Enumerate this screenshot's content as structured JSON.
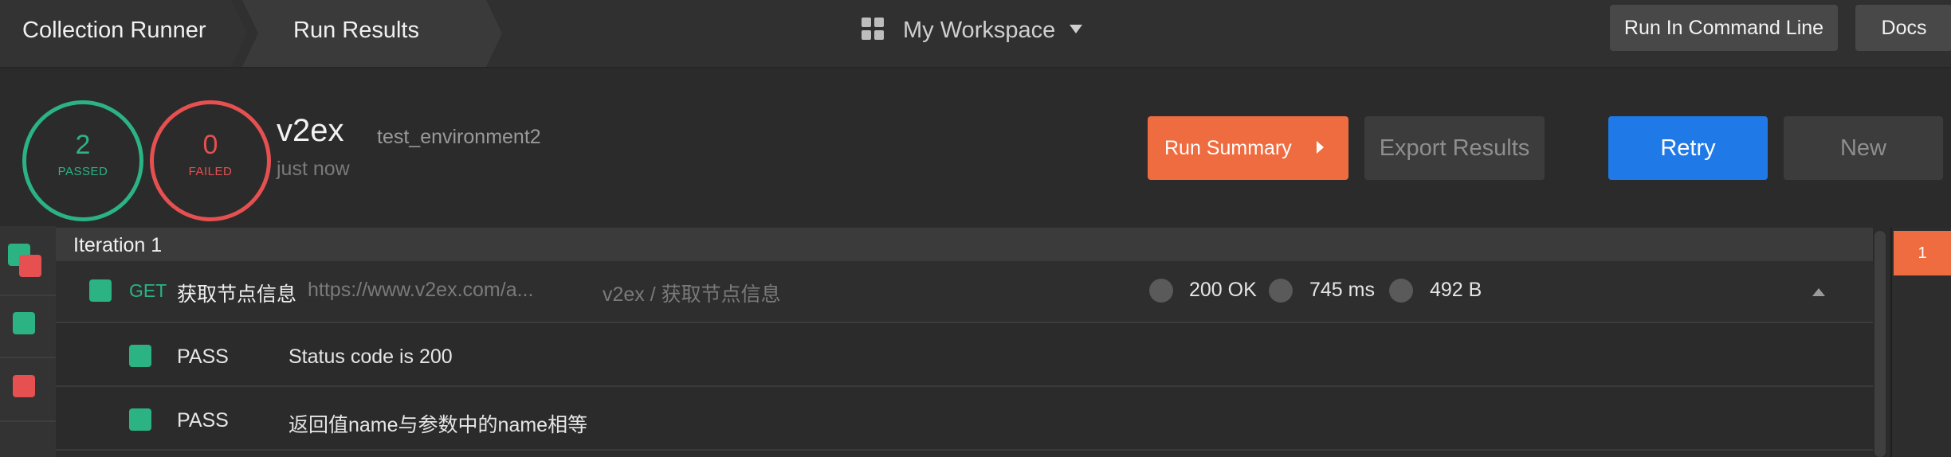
{
  "colors": {
    "passed": "#2bb383",
    "failed": "#e65050",
    "run_summary": "#ef6c40",
    "retry": "#1f7ae8"
  },
  "topbar": {
    "breadcrumb": [
      "Collection Runner",
      "Run Results"
    ],
    "workspace_label": "My Workspace",
    "run_cli_label": "Run In Command Line",
    "docs_label": "Docs"
  },
  "summary": {
    "passed_count": "2",
    "passed_label": "PASSED",
    "failed_count": "0",
    "failed_label": "FAILED",
    "collection_name": "v2ex",
    "environment": "test_environment2",
    "time": "just now"
  },
  "actions": {
    "run_summary_label": "Run Summary",
    "export_label": "Export Results",
    "retry_label": "Retry",
    "new_label": "New"
  },
  "iteration": {
    "title": "Iteration 1",
    "badge": "1"
  },
  "request": {
    "method": "GET",
    "name": "获取节点信息",
    "url": "https://www.v2ex.com/a...",
    "path": "v2ex / 获取节点信息",
    "status": "200 OK",
    "time": "745 ms",
    "size": "492 B"
  },
  "tests": [
    {
      "result": "PASS",
      "name": "Status code is 200"
    },
    {
      "result": "PASS",
      "name": "返回值name与参数中的name相等"
    }
  ]
}
